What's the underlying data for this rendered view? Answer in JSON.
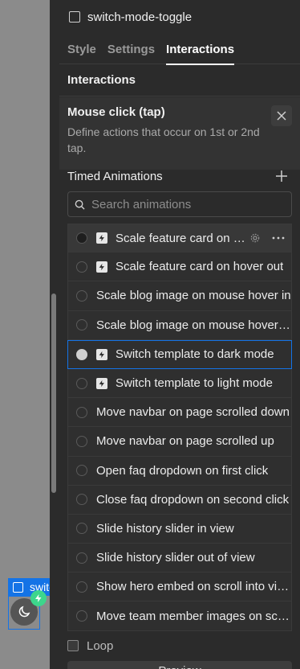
{
  "canvas": {
    "selection_label": "switch-mode-toggle"
  },
  "panel": {
    "element_name": "switch-mode-toggle",
    "tabs": [
      {
        "label": "Style"
      },
      {
        "label": "Settings"
      },
      {
        "label": "Interactions",
        "active": true
      }
    ],
    "section_title": "Interactions",
    "trigger": {
      "title": "Mouse click (tap)",
      "description": "Define actions that occur on 1st or 2nd tap."
    },
    "timed": {
      "title": "Timed Animations",
      "search_placeholder": "Search animations",
      "items": [
        {
          "label": "Scale feature card on hover in",
          "bolt": true,
          "hover": true
        },
        {
          "label": "Scale feature card on hover out",
          "bolt": true
        },
        {
          "label": "Scale blog image on mouse hover in",
          "bolt": false
        },
        {
          "label": "Scale blog image on mouse hover out",
          "bolt": false
        },
        {
          "label": "Switch template to dark mode",
          "bolt": true,
          "selected": true
        },
        {
          "label": "Switch template to light mode",
          "bolt": true
        },
        {
          "label": "Move navbar on page scrolled down",
          "bolt": false
        },
        {
          "label": "Move navbar on page scrolled up",
          "bolt": false
        },
        {
          "label": "Open faq dropdown on first click",
          "bolt": false
        },
        {
          "label": "Close faq dropdown on second click",
          "bolt": false
        },
        {
          "label": "Slide history slider in view",
          "bolt": false
        },
        {
          "label": "Slide history slider out of view",
          "bolt": false
        },
        {
          "label": "Show hero embed on scroll into view",
          "bolt": false
        },
        {
          "label": "Move team member images on scroll",
          "bolt": false
        }
      ]
    },
    "loop_label": "Loop",
    "bottom_button_label": "Preview"
  },
  "colors": {
    "selection_blue": "#1473e6",
    "badge_green": "#3dd68c",
    "panel_bg": "#2b2b2b"
  },
  "icons": {
    "element": "checkbox-square-icon",
    "close": "close-icon",
    "add": "plus-icon",
    "search": "search-icon",
    "action": "lightning-bolt-icon",
    "settings": "gear-icon",
    "more": "more-horizontal-icon",
    "moon": "moon-icon"
  }
}
